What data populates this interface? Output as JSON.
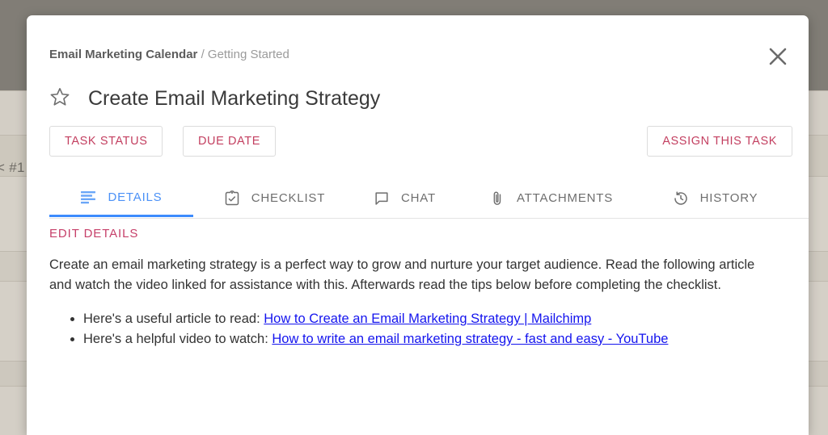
{
  "background": {
    "card_label": "< #1"
  },
  "modal": {
    "breadcrumb": {
      "parent": "Email Marketing Calendar",
      "separator": "/",
      "current": "Getting Started"
    },
    "close_icon": "close-icon",
    "favorite_icon": "star-outline-icon",
    "title": "Create Email Marketing Strategy",
    "actions": {
      "task_status": "TASK STATUS",
      "due_date": "DUE DATE",
      "assign_task": "ASSIGN THIS TASK"
    },
    "tabs": [
      {
        "id": "details",
        "label": "DETAILS",
        "icon": "subject-lines-icon",
        "active": true
      },
      {
        "id": "checklist",
        "label": "CHECKLIST",
        "icon": "clipboard-check-icon",
        "active": false
      },
      {
        "id": "chat",
        "label": "CHAT",
        "icon": "chat-bubble-icon",
        "active": false
      },
      {
        "id": "attachments",
        "label": "ATTACHMENTS",
        "icon": "paperclip-icon",
        "active": false
      },
      {
        "id": "history",
        "label": "HISTORY",
        "icon": "history-clock-icon",
        "active": false
      }
    ],
    "details": {
      "heading": "EDIT DETAILS",
      "paragraph": "Create an email marketing strategy is a perfect way to grow and nurture your target audience. Read the following article and watch the video linked for assistance with this. Afterwards read the tips below before completing the checklist.",
      "items": [
        {
          "prefix": "Here's a useful article to read: ",
          "link_text": "How to Create an Email Marketing Strategy | Mailchimp"
        },
        {
          "prefix": "Here's a helpful video to watch: ",
          "link_text": "How to write an email marketing strategy - fast and easy - YouTube"
        }
      ]
    }
  },
  "colors": {
    "accent_pink": "#c33f60",
    "tab_active_blue": "#3d8bfd",
    "link_blue": "#1414ee",
    "topbar": "#817d76",
    "page_background": "#cfcac1"
  }
}
